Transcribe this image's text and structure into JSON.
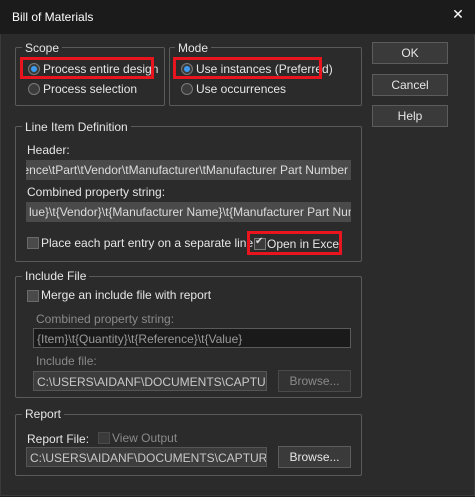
{
  "window": {
    "title": "Bill of Materials",
    "close_glyph": "✕"
  },
  "scope": {
    "legend": "Scope",
    "process_entire_design": "Process entire design",
    "process_selection": "Process selection",
    "selected": "process_entire_design"
  },
  "mode": {
    "legend": "Mode",
    "use_instances": "Use instances (Preferred)",
    "use_occurrences": "Use occurrences",
    "selected": "use_instances"
  },
  "buttons": {
    "ok": "OK",
    "cancel": "Cancel",
    "help": "Help"
  },
  "line_item": {
    "legend": "Line Item Definition",
    "header_label": "Header:",
    "header_value": "Reference\\tPart\\tVendor\\tManufacturer\\tManufacturer Part Number",
    "combined_label": "Combined property string:",
    "combined_value": "lue}\\t{Vendor}\\t{Manufacturer Name}\\t{Manufacturer Part Number}",
    "separate_line_label": "Place each part entry on a separate line",
    "separate_line_checked": false,
    "open_excel_label": "Open in Excel",
    "open_excel_checked": true
  },
  "include_file": {
    "legend": "Include File",
    "merge_label": "Merge an include file with report",
    "merge_checked": false,
    "combined_label": "Combined property string:",
    "combined_value": "{Item}\\t{Quantity}\\t{Reference}\\t{Value}",
    "file_label": "Include file:",
    "file_value": "C:\\USERS\\AIDANF\\DOCUMENTS\\CAPTURE",
    "browse_label": "Browse..."
  },
  "report": {
    "legend": "Report",
    "file_label": "Report File:",
    "view_output_label": "View Output",
    "view_output_checked": false,
    "file_value": "C:\\USERS\\AIDANF\\DOCUMENTS\\CAPTURE \\",
    "browse_label": "Browse..."
  },
  "colors": {
    "accent": "#3c9bf0",
    "highlight": "#e8141e",
    "background": "#2b2b2b"
  }
}
